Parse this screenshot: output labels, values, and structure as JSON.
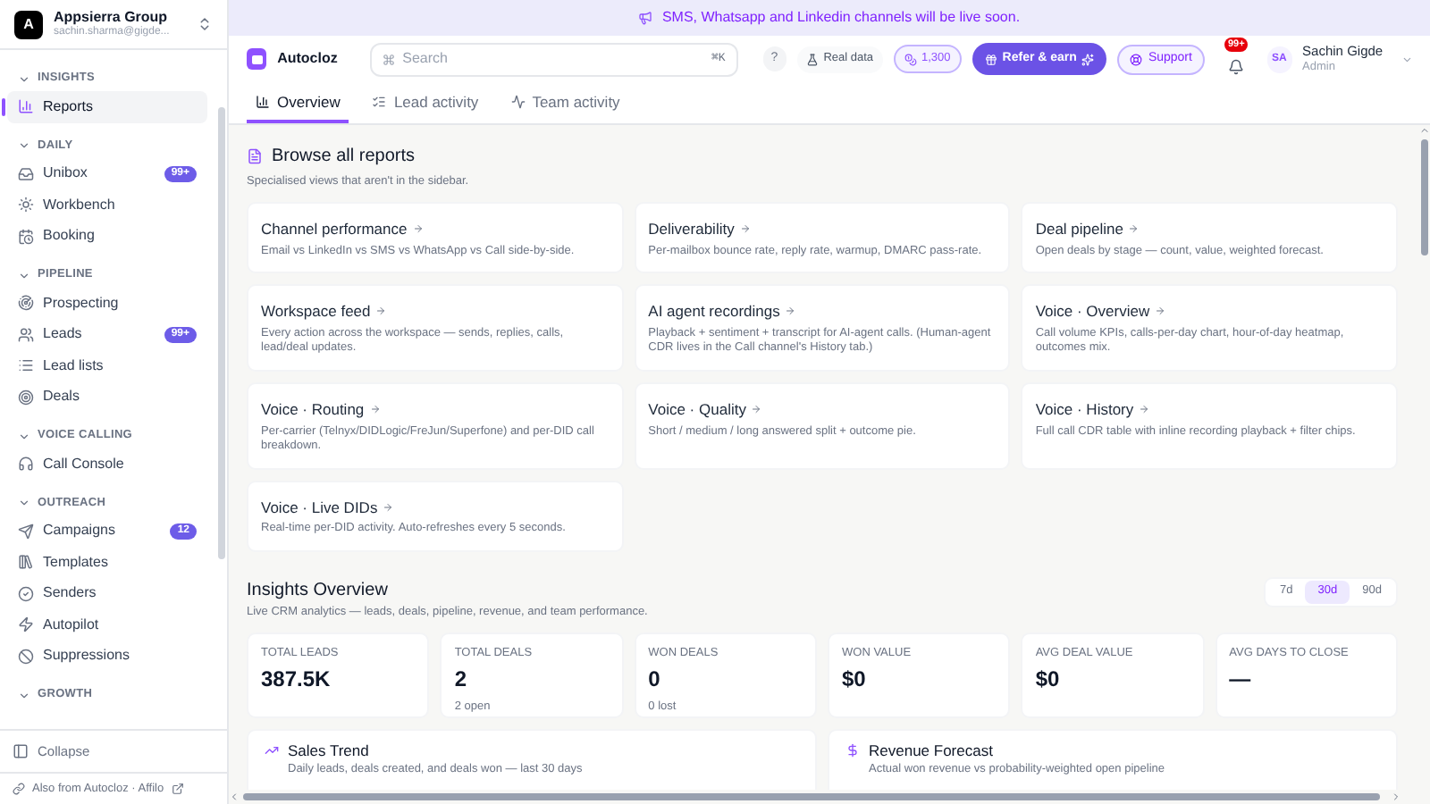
{
  "workspace": {
    "initial": "A",
    "name": "Appsierra Group",
    "email": "sachin.sharma@gigde..."
  },
  "sidebar": {
    "sections": [
      {
        "title": "INSIGHTS",
        "expanded": true,
        "items": [
          {
            "label": "Reports",
            "selected": true
          }
        ]
      },
      {
        "title": "DAILY",
        "expanded": true,
        "items": [
          {
            "label": "Unibox",
            "selected": false,
            "badge": "99+"
          },
          {
            "label": "Workbench",
            "selected": false
          },
          {
            "label": "Booking",
            "selected": false
          }
        ]
      },
      {
        "title": "PIPELINE",
        "expanded": true,
        "items": [
          {
            "label": "Prospecting",
            "selected": false
          },
          {
            "label": "Leads",
            "selected": false,
            "badge": "99+"
          },
          {
            "label": "Lead lists",
            "selected": false
          },
          {
            "label": "Deals",
            "selected": false
          }
        ]
      },
      {
        "title": "VOICE CALLING",
        "expanded": true,
        "items": [
          {
            "label": "Call Console",
            "selected": false
          }
        ]
      },
      {
        "title": "OUTREACH",
        "expanded": true,
        "items": [
          {
            "label": "Campaigns",
            "selected": false,
            "badge": "12"
          },
          {
            "label": "Templates",
            "selected": false
          },
          {
            "label": "Senders",
            "selected": false
          },
          {
            "label": "Autopilot",
            "selected": false
          },
          {
            "label": "Suppressions",
            "selected": false
          }
        ]
      },
      {
        "title": "GROWTH",
        "expanded": true
      }
    ],
    "collapse": "Collapse",
    "footer": "Also from Autocloz · Affilo"
  },
  "banner": {
    "text": "SMS, Whatsapp and Linkedin channels will be live soon."
  },
  "header": {
    "brand": "Autocloz",
    "search": {
      "placeholder": "Search",
      "shortcut": "⌘K"
    },
    "help": "?",
    "data_mode": "Real data",
    "credits": "1,300",
    "refer": "Refer & earn",
    "support": "Support",
    "notifications": "99+",
    "user": {
      "initials": "SA",
      "name": "Sachin Gigde",
      "role": "Admin"
    }
  },
  "tabs": [
    {
      "label": "Overview",
      "selected": true
    },
    {
      "label": "Lead activity",
      "selected": false
    },
    {
      "label": "Team activity",
      "selected": false
    }
  ],
  "reports": {
    "title": "Browse all reports",
    "subtitle": "Specialised views that aren't in the sidebar.",
    "items": [
      {
        "title": "Channel performance",
        "description": "Email vs LinkedIn vs SMS vs WhatsApp vs Call side-by-side."
      },
      {
        "title": "Deliverability",
        "description": "Per-mailbox bounce rate, reply rate, warmup, DMARC pass-rate."
      },
      {
        "title": "Deal pipeline",
        "description": "Open deals by stage — count, value, weighted forecast."
      },
      {
        "title": "Workspace feed",
        "description": "Every action across the workspace — sends, replies, calls, lead/deal updates."
      },
      {
        "title": "AI agent recordings",
        "description": "Playback + sentiment + transcript for AI-agent calls. (Human-agent CDR lives in the Call channel's History tab.)"
      },
      {
        "title": "Voice · Overview",
        "description": "Call volume KPIs, calls-per-day chart, hour-of-day heatmap, outcomes mix."
      },
      {
        "title": "Voice · Routing",
        "description": "Per-carrier (Telnyx/DIDLogic/FreJun/Superfone) and per-DID call breakdown."
      },
      {
        "title": "Voice · Quality",
        "description": "Short / medium / long answered split + outcome pie."
      },
      {
        "title": "Voice · History",
        "description": "Full call CDR table with inline recording playback + filter chips."
      },
      {
        "title": "Voice · Live DIDs",
        "description": "Real-time per-DID activity. Auto-refreshes every 5 seconds."
      }
    ]
  },
  "insights": {
    "title": "Insights Overview",
    "subtitle": "Live CRM analytics — leads, deals, pipeline, revenue, and team performance.",
    "ranges": [
      {
        "label": "7d",
        "selected": false
      },
      {
        "label": "30d",
        "selected": true
      },
      {
        "label": "90d",
        "selected": false
      }
    ],
    "kpis": [
      {
        "label": "TOTAL LEADS",
        "value": "387.5K"
      },
      {
        "label": "TOTAL DEALS",
        "value": "2",
        "note": "2 open"
      },
      {
        "label": "WON DEALS",
        "value": "0",
        "note": "0 lost"
      },
      {
        "label": "WON VALUE",
        "value": "$0"
      },
      {
        "label": "AVG DEAL VALUE",
        "value": "$0"
      },
      {
        "label": "AVG DAYS TO CLOSE",
        "value": "—"
      }
    ],
    "panels": [
      {
        "title": "Sales Trend",
        "subtitle": "Daily leads, deals created, and deals won — last 30 days"
      },
      {
        "title": "Revenue Forecast",
        "subtitle": "Actual won revenue vs probability-weighted open pipeline"
      }
    ]
  }
}
